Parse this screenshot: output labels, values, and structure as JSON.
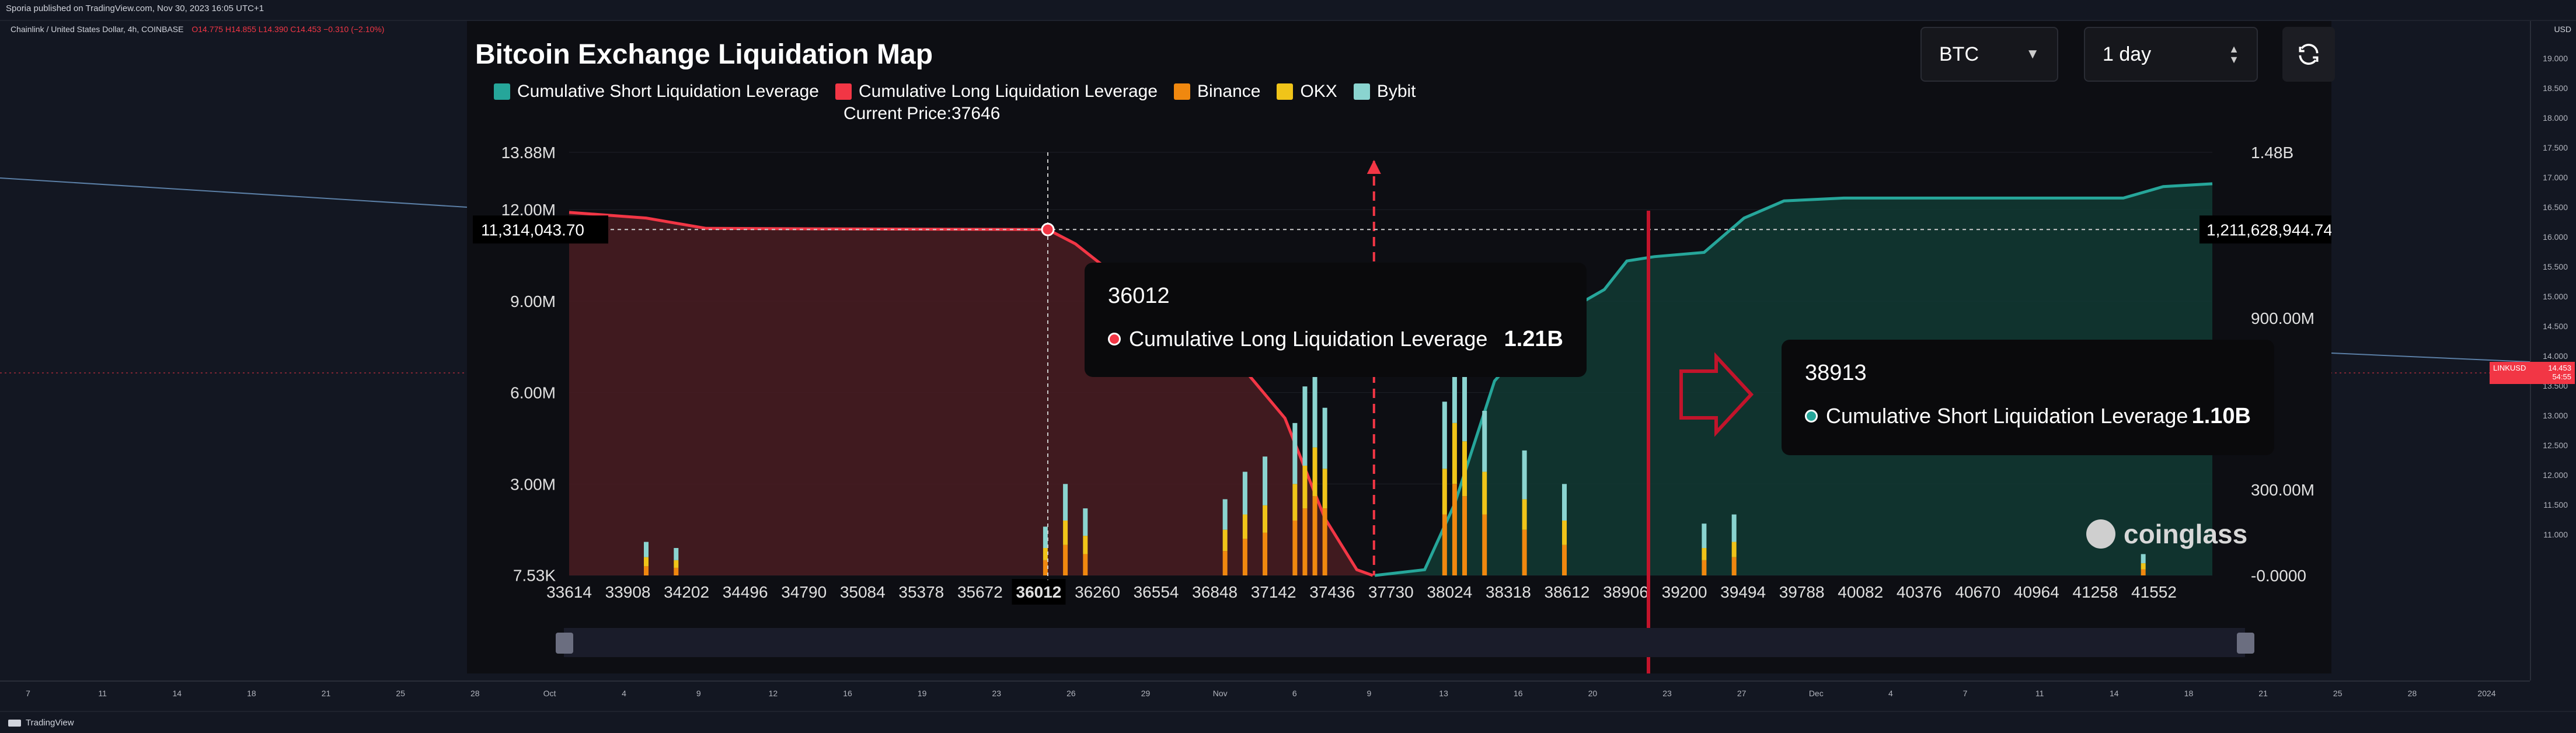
{
  "tradingview": {
    "published": "Sporia published on TradingView.com, Nov 30, 2023 16:05 UTC+1",
    "symbol_line": "Chainlink / United States Dollar, 4h, COINBASE",
    "ohlc": "O14.775  H14.855  L14.390  C14.453  −0.310 (−2.10%)",
    "currency": "USD",
    "price_scale": [
      "19.000",
      "18.500",
      "18.000",
      "17.500",
      "17.000",
      "16.500",
      "16.000",
      "15.500",
      "15.000",
      "14.500",
      "14.000",
      "13.500",
      "13.000",
      "12.500",
      "12.000",
      "11.500",
      "11.000"
    ],
    "price_tag": {
      "label": "LINKUSD",
      "value": "14.453",
      "countdown": "54:55"
    },
    "time_ticks": [
      "7",
      "11",
      "14",
      "18",
      "21",
      "25",
      "28",
      "Oct",
      "4",
      "9",
      "12",
      "16",
      "19",
      "23",
      "26",
      "29",
      "Nov",
      "6",
      "9",
      "13",
      "16",
      "20",
      "23",
      "27",
      "Dec",
      "4",
      "7",
      "11",
      "14",
      "18",
      "21",
      "25",
      "28",
      "2024"
    ],
    "brand": "TradingView",
    "line_color": "#5b7fa6"
  },
  "panel": {
    "title": "Bitcoin Exchange Liquidation Map",
    "symbol_select": "BTC",
    "range_select": "1 day",
    "refresh_icon": "refresh-icon",
    "current_price_label": "Current Price:37646",
    "watermark": "coinglass"
  },
  "legend": [
    {
      "name": "Cumulative Short Liquidation Leverage",
      "color": "#26a69a"
    },
    {
      "name": "Cumulative Long Liquidation Leverage",
      "color": "#f23645"
    },
    {
      "name": "Binance",
      "color": "#f0880f"
    },
    {
      "name": "OKX",
      "color": "#f0c419"
    },
    {
      "name": "Bybit",
      "color": "#8ad4d0"
    }
  ],
  "tooltips": {
    "long": {
      "title": "36012",
      "label": "Cumulative Long Liquidation Leverage",
      "value": "1.21B"
    },
    "short": {
      "title": "38913",
      "label": "Cumulative Short Liquidation Leverage",
      "value": "1.10B"
    }
  },
  "crosshair": {
    "x_value": "36012",
    "left_value": "11,314,043.70",
    "right_value": "1,211,628,944.74"
  },
  "chart_data": {
    "type": "bar",
    "x_ticks": [
      "33614",
      "33908",
      "34202",
      "34496",
      "34790",
      "35084",
      "35378",
      "35672",
      "36012",
      "36260",
      "36554",
      "36848",
      "37142",
      "37436",
      "37730",
      "38024",
      "38318",
      "38612",
      "38906",
      "39200",
      "39494",
      "39788",
      "40082",
      "40376",
      "40670",
      "40964",
      "41258",
      "41552"
    ],
    "x_range": [
      33614,
      41846
    ],
    "current_price": 37646,
    "left_axis_ticks": [
      "13.88M",
      "12.00M",
      "9.00M",
      "6.00M",
      "3.00M",
      "7.53K"
    ],
    "left_axis_values": [
      13880000,
      12000000,
      9000000,
      6000000,
      3000000,
      7530
    ],
    "right_axis_ticks": [
      "1.48B",
      "900.00M",
      "300.00M",
      "-0.0000"
    ],
    "right_axis_values": [
      1480000000,
      900000000,
      300000000,
      0
    ],
    "cumulative_long": {
      "name": "Cumulative Long Liquidation Leverage",
      "points": [
        [
          33614,
          1270000000.0
        ],
        [
          34000,
          1250000000.0
        ],
        [
          34300,
          1214000000.0
        ],
        [
          35000,
          1212000000.0
        ],
        [
          36012,
          1210000000.0
        ],
        [
          36150,
          1160000000.0
        ],
        [
          36350,
          1050000000.0
        ],
        [
          36600,
          950000000.0
        ],
        [
          36900,
          800000000.0
        ],
        [
          37200,
          550000000.0
        ],
        [
          37400,
          200000000.0
        ],
        [
          37560,
          20000000.0
        ],
        [
          37640,
          0
        ]
      ]
    },
    "cumulative_short": {
      "name": "Cumulative Short Liquidation Leverage",
      "points": [
        [
          37650,
          0
        ],
        [
          37900,
          20000000.0
        ],
        [
          38050,
          250000000.0
        ],
        [
          38250,
          680000000.0
        ],
        [
          38500,
          880000000.0
        ],
        [
          38800,
          1000000000.0
        ],
        [
          38913,
          1100000000.0
        ],
        [
          39050,
          1115000000.0
        ],
        [
          39300,
          1130000000.0
        ],
        [
          39500,
          1250000000.0
        ],
        [
          39700,
          1310000000.0
        ],
        [
          40000,
          1320000000.0
        ],
        [
          41000,
          1320000000.0
        ],
        [
          41400,
          1320000000.0
        ],
        [
          41600,
          1360000000.0
        ],
        [
          41846,
          1370000000.0
        ]
      ]
    },
    "exchange_bars": [
      {
        "price": 34000,
        "binance": 300000.0,
        "okx": 300000.0,
        "bybit": 500000.0
      },
      {
        "price": 34150,
        "binance": 250000.0,
        "okx": 250000.0,
        "bybit": 400000.0
      },
      {
        "price": 36000,
        "binance": 500000.0,
        "okx": 400000.0,
        "bybit": 700000.0
      },
      {
        "price": 36100,
        "binance": 1000000.0,
        "okx": 800000.0,
        "bybit": 1200000.0
      },
      {
        "price": 36200,
        "binance": 700000.0,
        "okx": 600000.0,
        "bybit": 900000.0
      },
      {
        "price": 36900,
        "binance": 800000.0,
        "okx": 700000.0,
        "bybit": 1000000.0
      },
      {
        "price": 37000,
        "binance": 1200000.0,
        "okx": 800000.0,
        "bybit": 1400000.0
      },
      {
        "price": 37100,
        "binance": 1400000.0,
        "okx": 900000.0,
        "bybit": 1600000.0
      },
      {
        "price": 37250,
        "binance": 1800000.0,
        "okx": 1200000.0,
        "bybit": 2000000.0
      },
      {
        "price": 37300,
        "binance": 2200000.0,
        "okx": 1400000.0,
        "bybit": 2600000.0
      },
      {
        "price": 37350,
        "binance": 2600000.0,
        "okx": 1600000.0,
        "bybit": 2800000.0
      },
      {
        "price": 37400,
        "binance": 2200000.0,
        "okx": 1300000.0,
        "bybit": 2000000.0
      },
      {
        "price": 38000,
        "binance": 2000000.0,
        "okx": 1500000.0,
        "bybit": 2200000.0
      },
      {
        "price": 38050,
        "binance": 3000000.0,
        "okx": 2000000.0,
        "bybit": 3500000.0
      },
      {
        "price": 38100,
        "binance": 2600000.0,
        "okx": 1800000.0,
        "bybit": 2800000.0
      },
      {
        "price": 38200,
        "binance": 2000000.0,
        "okx": 1400000.0,
        "bybit": 2000000.0
      },
      {
        "price": 38400,
        "binance": 1500000.0,
        "okx": 1000000.0,
        "bybit": 1600000.0
      },
      {
        "price": 38600,
        "binance": 1000000.0,
        "okx": 800000.0,
        "bybit": 1200000.0
      },
      {
        "price": 39300,
        "binance": 500000.0,
        "okx": 400000.0,
        "bybit": 800000.0
      },
      {
        "price": 39450,
        "binance": 600000.0,
        "okx": 500000.0,
        "bybit": 900000.0
      },
      {
        "price": 41500,
        "binance": 200000.0,
        "okx": 200000.0,
        "bybit": 300000.0
      }
    ]
  }
}
